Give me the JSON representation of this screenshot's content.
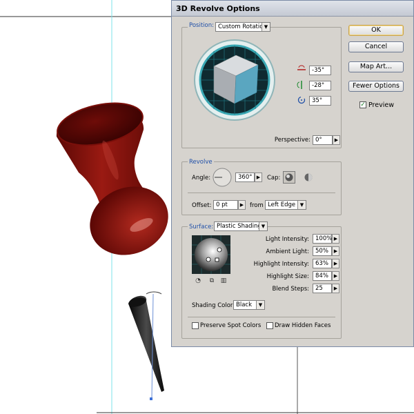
{
  "dialog": {
    "title": "3D Revolve Options",
    "buttons": {
      "ok": "OK",
      "cancel": "Cancel",
      "map_art": "Map Art...",
      "fewer_options": "Fewer Options"
    },
    "preview": {
      "label": "Preview",
      "checked": true,
      "mark": "✓"
    }
  },
  "position": {
    "label": "Position:",
    "preset": "Custom Rotation",
    "x_rotation": "-35°",
    "y_rotation": "-28°",
    "z_rotation": "35°",
    "perspective_label": "Perspective:",
    "perspective": "0°"
  },
  "revolve": {
    "label": "Revolve",
    "angle_label": "Angle:",
    "angle": "360°",
    "cap_label": "Cap:",
    "offset_label": "Offset:",
    "offset": "0 pt",
    "from_label": "from",
    "from": "Left Edge"
  },
  "surface": {
    "label": "Surface:",
    "type": "Plastic Shading",
    "light_intensity_label": "Light Intensity:",
    "light_intensity": "100%",
    "ambient_light_label": "Ambient Light:",
    "ambient_light": "50%",
    "highlight_intensity_label": "Highlight Intensity:",
    "highlight_intensity": "63%",
    "highlight_size_label": "Highlight Size:",
    "highlight_size": "84%",
    "blend_steps_label": "Blend Steps:",
    "blend_steps": "25",
    "shading_color_label": "Shading Color:",
    "shading_color": "Black",
    "preserve_spot_colors": "Preserve Spot Colors",
    "draw_hidden_faces": "Draw Hidden Faces"
  },
  "glyphs": {
    "spin_arrow": "▶",
    "drop_arrow": "▼"
  },
  "colors": {
    "accent": "#1f4fa8",
    "pin_red": "#8b120c",
    "guide_cyan": "#7ee3ea",
    "cube_face": "#5aa6c0"
  },
  "icons": [
    "x-axis-rotation-icon",
    "y-axis-rotation-icon",
    "z-axis-rotation-icon",
    "cap-on-icon",
    "cap-off-icon",
    "new-light-icon",
    "move-light-back-icon",
    "delete-light-icon"
  ]
}
